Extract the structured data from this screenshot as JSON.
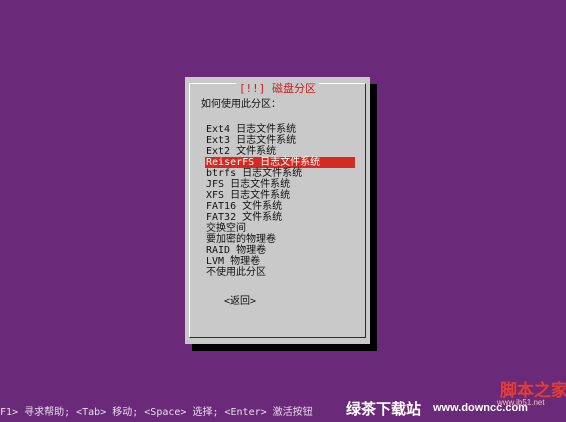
{
  "dialog": {
    "title": "[!!] 磁盘分区",
    "prompt": "如何使用此分区：",
    "options": [
      "Ext4 日志文件系统",
      "Ext3 日志文件系统",
      "Ext2 文件系统",
      "ReiserFS 日志文件系统",
      "btrfs 日志文件系统",
      "JFS 日志文件系统",
      "XFS 日志文件系统",
      "FAT16 文件系统",
      "FAT32 文件系统",
      "交换空间",
      "要加密的物理卷",
      "RAID 物理卷",
      "LVM 物理卷",
      "不使用此分区"
    ],
    "selected_option": "ReiserFS 日志文件系统",
    "back_label": "<返回>"
  },
  "status_bar": {
    "text": "F1> 寻求帮助; <Tab> 移动; <Space> 选择; <Enter> 激活按钮"
  },
  "watermark": {
    "site_name": "绿茶下载站",
    "site_url": "www.downcc.com",
    "logo_text": "脚本之家",
    "logo_url": "www.jb51.net"
  },
  "colors": {
    "background": "#6b2a79",
    "dialog_bg": "#c9c9c9",
    "highlight": "#d52a22",
    "title_text": "#c91f1f"
  }
}
